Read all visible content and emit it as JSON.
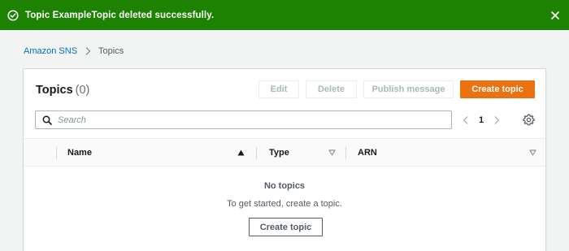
{
  "flash": {
    "message": "Topic ExampleTopic deleted successfully.",
    "color": "#1d8102"
  },
  "breadcrumb": {
    "items": [
      "Amazon SNS",
      "Topics"
    ]
  },
  "panel": {
    "title": "Topics",
    "count": "(0)"
  },
  "toolbar": {
    "edit_label": "Edit",
    "delete_label": "Delete",
    "publish_label": "Publish message",
    "create_label": "Create topic",
    "primary_color": "#ec7211"
  },
  "search": {
    "placeholder": "Search",
    "value": ""
  },
  "pagination": {
    "current_page": "1"
  },
  "table": {
    "columns": [
      "Name",
      "Type",
      "ARN"
    ],
    "sorted_column": "Name",
    "rows": []
  },
  "empty_state": {
    "title": "No topics",
    "description": "To get started, create a topic.",
    "button_label": "Create topic"
  }
}
